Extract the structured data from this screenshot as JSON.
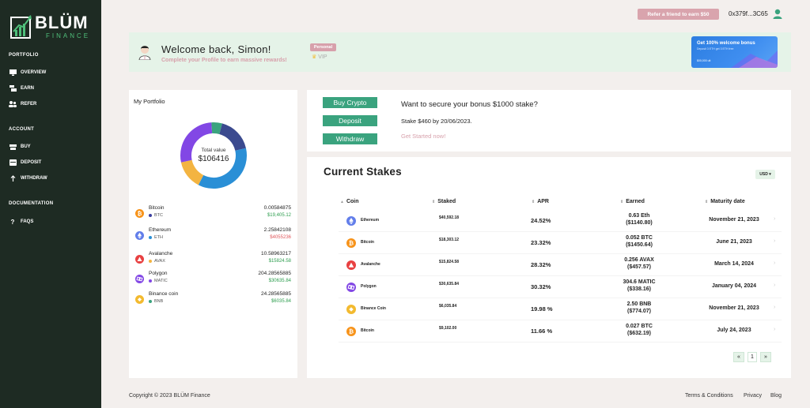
{
  "brand": {
    "name": "BLÜM",
    "sub": "FINANCE"
  },
  "sidebar": {
    "sections": [
      {
        "label": "PORTFOLIO",
        "items": [
          {
            "label": "OVERVIEW",
            "icon": "monitor-icon"
          },
          {
            "label": "EARN",
            "icon": "earn-icon"
          },
          {
            "label": "REFER",
            "icon": "users-icon"
          }
        ]
      },
      {
        "label": "ACCOUNT",
        "items": [
          {
            "label": "BUY",
            "icon": "cart-icon"
          },
          {
            "label": "DEPOSIT",
            "icon": "deposit-icon"
          },
          {
            "label": "WITHDRAW",
            "icon": "arrow-up-icon"
          }
        ]
      },
      {
        "label": "DOCUMENTATION",
        "items": [
          {
            "label": "FAQS",
            "icon": "question-icon"
          }
        ]
      }
    ]
  },
  "header": {
    "refer_label": "Refer a friend to earn $50",
    "wallet": "0x379f...3C65"
  },
  "welcome": {
    "title": "Welcome back, Simon!",
    "subtitle": "Complete your Profile to earn massive rewards!",
    "badge": "Personal",
    "tier": "VIP",
    "bonus_card": {
      "title": "Get 100% welcome bonus",
      "line": "Deposit 3 ETH get 3 ETH free",
      "footer": "$00,000 ult"
    }
  },
  "portfolio": {
    "title": "My Portfolio",
    "total_label": "Total value",
    "total_value": "$106416",
    "assets": [
      {
        "name": "Bitcoin",
        "symbol": "BTC",
        "amount": "0.00584875",
        "value": "$19,405.12",
        "value_color": "#2e9e4f",
        "color": "#f7931a",
        "dot": "#3b3f9f"
      },
      {
        "name": "Ethereum",
        "symbol": "ETH",
        "amount": "2.25842108",
        "value": "$4055236",
        "value_color": "#e0575b",
        "color": "#627eea",
        "dot": "#2a8fd6"
      },
      {
        "name": "Avalanche",
        "symbol": "AVAX",
        "amount": "10.58963217",
        "value": "$15824.58",
        "value_color": "#2e9e4f",
        "color": "#e84142",
        "dot": "#f3b441"
      },
      {
        "name": "Polygon",
        "symbol": "MATIC",
        "amount": "204.28565885",
        "value": "$30635.84",
        "value_color": "#2e9e4f",
        "color": "#8247e5",
        "dot": "#8247e5"
      },
      {
        "name": "Binance coin",
        "symbol": "BNB",
        "amount": "24.28565885",
        "value": "$6035.84",
        "value_color": "#2e9e4f",
        "color": "#f3ba2f",
        "dot": "#3aa37e"
      }
    ]
  },
  "chart_data": {
    "type": "pie",
    "categories": [
      "Bitcoin",
      "Ethereum",
      "Avalanche",
      "Polygon",
      "Binance coin"
    ],
    "values": [
      19405.12,
      40552.36,
      15824.58,
      30635.84,
      6035.84
    ],
    "colors": [
      "#3b4a8f",
      "#2a8fd6",
      "#f3b441",
      "#8247e5",
      "#3aa37e"
    ],
    "title": "",
    "donut": true
  },
  "actions": {
    "buttons": [
      "Buy Crypto",
      "Deposit",
      "Withdraw"
    ],
    "cta_title": "Want to secure your bonus $1000 stake?",
    "cta_sub": "Stake $460 by 20/06/2023.",
    "cta_link": "Get Started now!"
  },
  "stakes": {
    "title": "Current Stakes",
    "currency": "USD ▾",
    "columns": [
      "Coin",
      "Staked",
      "APR",
      "Earned",
      "Maturity date"
    ],
    "rows": [
      {
        "coin": "Ethereum",
        "color": "#627eea",
        "staked": "$40,592.18",
        "apr": "24.52%",
        "earned1": "0.63 Eth",
        "earned2": "($1140.80)",
        "maturity": "November 21, 2023"
      },
      {
        "coin": "Bitcoin",
        "color": "#f7931a",
        "staked": "$18,303.12",
        "apr": "23.32%",
        "earned1": "0.052 BTC",
        "earned2": "($1450.64)",
        "maturity": "June 21, 2023"
      },
      {
        "coin": "Avalanche",
        "color": "#e84142",
        "staked": "$15,824.58",
        "apr": "28.32%",
        "earned1": "0.256 AVAX",
        "earned2": "($457.57)",
        "maturity": "March 14, 2024"
      },
      {
        "coin": "Polygon",
        "color": "#8247e5",
        "staked": "$30,635.84",
        "apr": "30.32%",
        "earned1": "304.6 MATIC",
        "earned2": "($338.16)",
        "maturity": "January 04, 2024"
      },
      {
        "coin": "Binance Coin",
        "color": "#f3ba2f",
        "staked": "$6,035.84",
        "apr": "19.98 %",
        "earned1": "2.50 BNB",
        "earned2": "($774.07)",
        "maturity": "November 21, 2023"
      },
      {
        "coin": "Bitcoin",
        "color": "#f7931a",
        "staked": "$9,102.00",
        "apr": "11.66 %",
        "earned1": "0.027 BTC",
        "earned2": "($632.19)",
        "maturity": "July 24, 2023"
      }
    ],
    "pagination": {
      "prev": "«",
      "page": "1",
      "next": "»"
    }
  },
  "footer": {
    "copyright": "Copyright © 2023 BLÜM Finance",
    "links": [
      "Terms & Conditions",
      "Privacy",
      "Blog"
    ]
  }
}
